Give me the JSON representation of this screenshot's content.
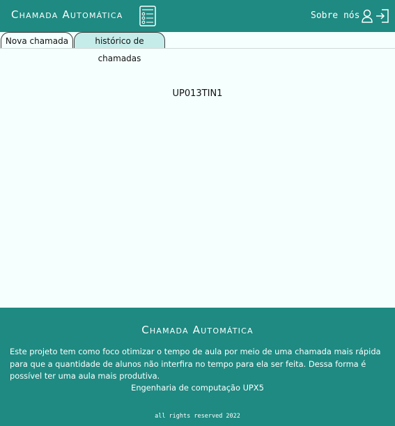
{
  "header": {
    "brand": "Chamada Automática",
    "brand_icon": "checklist-icon",
    "about_label": "Sobre nós",
    "user_icon": "user-icon",
    "login_icon": "login-icon"
  },
  "tabs": [
    {
      "label": "Nova chamada",
      "active": true
    },
    {
      "label": "histórico de chamadas",
      "active": false
    }
  ],
  "main": {
    "class_code": "UP013TIN1"
  },
  "footer": {
    "title": "Chamada Automática",
    "description": "Este projeto tem como foco otimizar o tempo de aula por meio de uma chamada mais rápida para que a quantidade de alunos não interfira no tempo para ela ser feita. Dessa forma é possível ter uma aula mais produtiva.",
    "course": "Engenharia de computação UPX5",
    "rights": "all rights reserved 2022"
  },
  "colors": {
    "primary": "#1e8a82",
    "background": "#f5fffd",
    "inactive_tab": "#c6ecea"
  }
}
